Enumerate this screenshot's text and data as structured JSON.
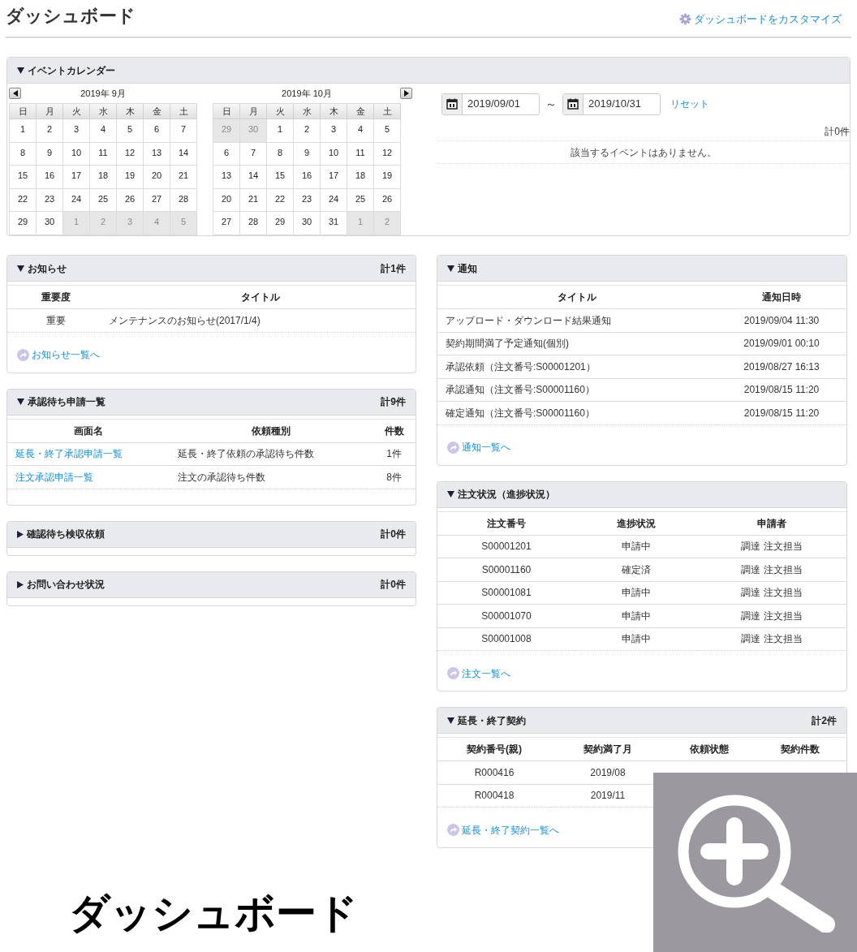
{
  "page": {
    "title": "ダッシュボード",
    "customize_link": "ダッシュボードをカスタマイズ"
  },
  "calendar_panel": {
    "title": "イベントカレンダー",
    "expanded": true,
    "months": [
      {
        "label": "2019年 9月",
        "weekdays": [
          "日",
          "月",
          "火",
          "水",
          "木",
          "金",
          "土"
        ],
        "weeks": [
          [
            {
              "day": "1",
              "outside": false
            },
            {
              "day": "2",
              "outside": false
            },
            {
              "day": "3",
              "outside": false
            },
            {
              "day": "4",
              "outside": false
            },
            {
              "day": "5",
              "outside": false
            },
            {
              "day": "6",
              "outside": false
            },
            {
              "day": "7",
              "outside": false
            }
          ],
          [
            {
              "day": "8",
              "outside": false
            },
            {
              "day": "9",
              "outside": false
            },
            {
              "day": "10",
              "outside": false
            },
            {
              "day": "11",
              "outside": false
            },
            {
              "day": "12",
              "outside": false
            },
            {
              "day": "13",
              "outside": false
            },
            {
              "day": "14",
              "outside": false
            }
          ],
          [
            {
              "day": "15",
              "outside": false
            },
            {
              "day": "16",
              "outside": false
            },
            {
              "day": "17",
              "outside": false
            },
            {
              "day": "18",
              "outside": false
            },
            {
              "day": "19",
              "outside": false
            },
            {
              "day": "20",
              "outside": false
            },
            {
              "day": "21",
              "outside": false
            }
          ],
          [
            {
              "day": "22",
              "outside": false
            },
            {
              "day": "23",
              "outside": false
            },
            {
              "day": "24",
              "outside": false
            },
            {
              "day": "25",
              "outside": false
            },
            {
              "day": "26",
              "outside": false
            },
            {
              "day": "27",
              "outside": false
            },
            {
              "day": "28",
              "outside": false
            }
          ],
          [
            {
              "day": "29",
              "outside": false
            },
            {
              "day": "30",
              "outside": false
            },
            {
              "day": "1",
              "outside": true
            },
            {
              "day": "2",
              "outside": true
            },
            {
              "day": "3",
              "outside": true
            },
            {
              "day": "4",
              "outside": true
            },
            {
              "day": "5",
              "outside": true
            }
          ]
        ]
      },
      {
        "label": "2019年 10月",
        "weekdays": [
          "日",
          "月",
          "火",
          "水",
          "木",
          "金",
          "土"
        ],
        "weeks": [
          [
            {
              "day": "29",
              "outside": true
            },
            {
              "day": "30",
              "outside": true
            },
            {
              "day": "1",
              "outside": false
            },
            {
              "day": "2",
              "outside": false
            },
            {
              "day": "3",
              "outside": false
            },
            {
              "day": "4",
              "outside": false
            },
            {
              "day": "5",
              "outside": false
            }
          ],
          [
            {
              "day": "6",
              "outside": false
            },
            {
              "day": "7",
              "outside": false
            },
            {
              "day": "8",
              "outside": false
            },
            {
              "day": "9",
              "outside": false
            },
            {
              "day": "10",
              "outside": false
            },
            {
              "day": "11",
              "outside": false
            },
            {
              "day": "12",
              "outside": false
            }
          ],
          [
            {
              "day": "13",
              "outside": false
            },
            {
              "day": "14",
              "outside": false
            },
            {
              "day": "15",
              "outside": false
            },
            {
              "day": "16",
              "outside": false
            },
            {
              "day": "17",
              "outside": false
            },
            {
              "day": "18",
              "outside": false
            },
            {
              "day": "19",
              "outside": false
            }
          ],
          [
            {
              "day": "20",
              "outside": false
            },
            {
              "day": "21",
              "outside": false
            },
            {
              "day": "22",
              "outside": false
            },
            {
              "day": "23",
              "outside": false
            },
            {
              "day": "24",
              "outside": false
            },
            {
              "day": "25",
              "outside": false
            },
            {
              "day": "26",
              "outside": false
            }
          ],
          [
            {
              "day": "27",
              "outside": false
            },
            {
              "day": "28",
              "outside": false
            },
            {
              "day": "29",
              "outside": false
            },
            {
              "day": "30",
              "outside": false
            },
            {
              "day": "31",
              "outside": false
            },
            {
              "day": "1",
              "outside": true
            },
            {
              "day": "2",
              "outside": true
            }
          ]
        ]
      }
    ],
    "date_from": "2019/09/01",
    "separator": "～",
    "date_to": "2019/10/31",
    "reset_link": "リセット",
    "count": "計0件",
    "empty_message": "該当するイベントはありません。"
  },
  "left_panels": [
    {
      "title": "お知らせ",
      "expanded": true,
      "count": "計1件",
      "columns": [
        "重要度",
        "タイトル"
      ],
      "rows": [
        [
          {
            "text": "重要",
            "kind": "text"
          },
          {
            "text": "メンテナンスのお知らせ(2017/1/4)",
            "kind": "text"
          }
        ]
      ],
      "link": "お知らせ一覧へ"
    },
    {
      "title": "承認待ち申請一覧",
      "expanded": true,
      "count": "計9件",
      "columns": [
        "画面名",
        "依頼種別",
        "件数"
      ],
      "rows": [
        [
          {
            "text": "延長・終了承認申請一覧",
            "kind": "link"
          },
          {
            "text": "延長・終了依頼の承認待ち件数",
            "kind": "text"
          },
          {
            "text": "1件",
            "kind": "text"
          }
        ],
        [
          {
            "text": "注文承認申請一覧",
            "kind": "link"
          },
          {
            "text": "注文の承認待ち件数",
            "kind": "text"
          },
          {
            "text": "8件",
            "kind": "text"
          }
        ]
      ]
    },
    {
      "title": "確認待ち検収依頼",
      "expanded": false,
      "count": "計0件"
    },
    {
      "title": "お問い合わせ状況",
      "expanded": false,
      "count": "計0件"
    }
  ],
  "right_panels": [
    {
      "title": "通知",
      "expanded": true,
      "columns": [
        "タイトル",
        "通知日時"
      ],
      "rows": [
        [
          {
            "text": "アップロード・ダウンロード結果通知",
            "kind": "text"
          },
          {
            "text": "2019/09/04 11:30",
            "kind": "text"
          }
        ],
        [
          {
            "text": "契約期間満了予定通知(個別)",
            "kind": "text"
          },
          {
            "text": "2019/09/01 00:10",
            "kind": "text"
          }
        ],
        [
          {
            "text": "承認依頼（注文番号:S00001201）",
            "kind": "text"
          },
          {
            "text": "2019/08/27 16:13",
            "kind": "text"
          }
        ],
        [
          {
            "text": "承認通知（注文番号:S00001160）",
            "kind": "text"
          },
          {
            "text": "2019/08/15 11:20",
            "kind": "text"
          }
        ],
        [
          {
            "text": "確定通知（注文番号:S00001160）",
            "kind": "text"
          },
          {
            "text": "2019/08/15 11:20",
            "kind": "text"
          }
        ]
      ],
      "link": "通知一覧へ"
    },
    {
      "title": "注文状況（進捗状況）",
      "expanded": true,
      "columns": [
        "注文番号",
        "進捗状況",
        "申請者"
      ],
      "rows": [
        [
          {
            "text": "S00001201",
            "kind": "text"
          },
          {
            "text": "申請中",
            "kind": "text"
          },
          {
            "text": "調達 注文担当",
            "kind": "text"
          }
        ],
        [
          {
            "text": "S00001160",
            "kind": "text"
          },
          {
            "text": "確定済",
            "kind": "text"
          },
          {
            "text": "調達 注文担当",
            "kind": "text"
          }
        ],
        [
          {
            "text": "S00001081",
            "kind": "text"
          },
          {
            "text": "申請中",
            "kind": "text"
          },
          {
            "text": "調達 注文担当",
            "kind": "text"
          }
        ],
        [
          {
            "text": "S00001070",
            "kind": "text"
          },
          {
            "text": "申請中",
            "kind": "text"
          },
          {
            "text": "調達 注文担当",
            "kind": "text"
          }
        ],
        [
          {
            "text": "S00001008",
            "kind": "text"
          },
          {
            "text": "申請中",
            "kind": "text"
          },
          {
            "text": "調達 注文担当",
            "kind": "text"
          }
        ]
      ],
      "link": "注文一覧へ"
    },
    {
      "title": "延長・終了契約",
      "expanded": true,
      "count": "計2件",
      "columns": [
        "契約番号(親)",
        "契約満了月",
        "依頼状態",
        "契約件数"
      ],
      "rows": [
        [
          {
            "text": "R000416",
            "kind": "text"
          },
          {
            "text": "2019/08",
            "kind": "text"
          }
        ],
        [
          {
            "text": "R000418",
            "kind": "text"
          },
          {
            "text": "2019/11",
            "kind": "text"
          }
        ]
      ],
      "link": "延長・終了契約一覧へ"
    }
  ],
  "caption": "ダッシュボード"
}
